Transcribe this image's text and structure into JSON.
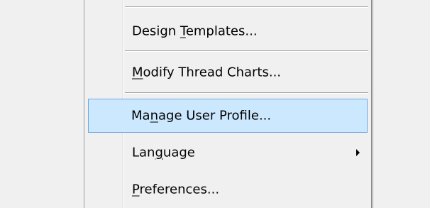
{
  "menu": {
    "items": [
      {
        "pre": "Design ",
        "accel": "T",
        "post": "emplates..."
      },
      {
        "pre": "",
        "accel": "M",
        "post": "odify Thread Charts..."
      },
      {
        "pre": "Ma",
        "accel": "n",
        "post": "age User Profile..."
      },
      {
        "pre": "Lan",
        "accel": "g",
        "post": "uage"
      },
      {
        "pre": "",
        "accel": "P",
        "post": "references..."
      }
    ]
  },
  "colors": {
    "highlight_background": "#cce8ff",
    "highlight_border": "#6da8e0",
    "menu_background": "#f0f0f0"
  }
}
